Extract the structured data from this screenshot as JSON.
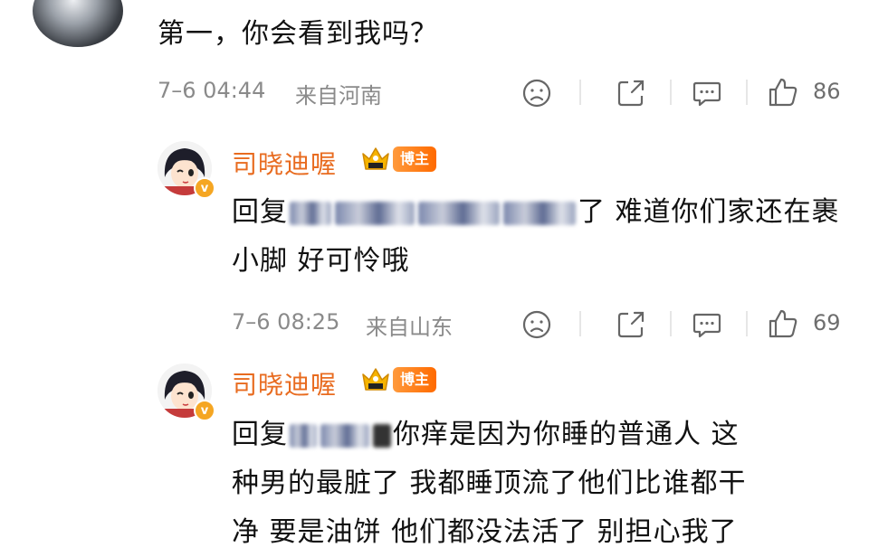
{
  "comment": {
    "text": "第一，你会看到我吗？",
    "time": "7–6 04:44",
    "location": "来自河南",
    "likes": "86"
  },
  "replies": [
    {
      "username": "司晓迪喔",
      "tag": "博主",
      "prefix": "回复",
      "text_line1": "了 难道你们家还在裹",
      "text_line2": "小脚 好可怜哦",
      "time": "7–6 08:25",
      "location": "来自山东",
      "likes": "69"
    },
    {
      "username": "司晓迪喔",
      "tag": "博主",
      "prefix": "回复",
      "text_line1": "你痒是因为你睡的普通人 这",
      "text_line2": "种男的最脏了 我都睡顶流了他们比谁都干",
      "text_line3": "净 要是油饼 他们都没法活了 别担心我了"
    }
  ],
  "icons": {
    "dislike": "sad-face-icon",
    "share": "share-icon",
    "comment": "comment-icon",
    "like": "thumbs-up-icon",
    "verified": "verified-v-icon",
    "crown": "crown-icon"
  },
  "colors": {
    "username": "#e86b1f",
    "tag_bg": "#ff7a1a",
    "meta": "#8a8a8a"
  }
}
